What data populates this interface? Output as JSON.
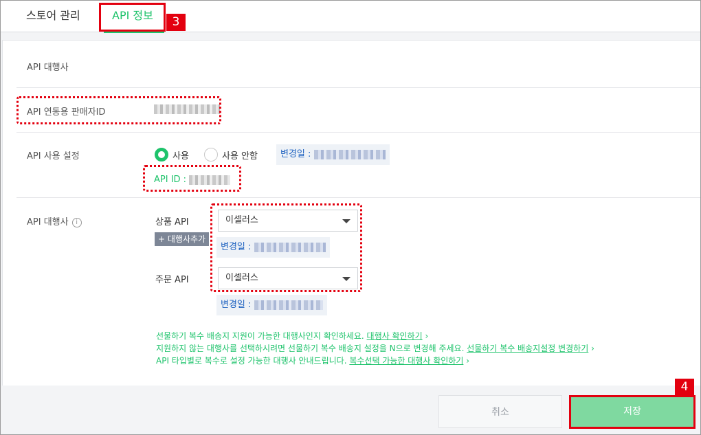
{
  "tabs": {
    "store_manage": "스토어 관리",
    "api_info": "API 정보",
    "badge_step3": "3"
  },
  "form": {
    "agency_label": "API 대행사",
    "seller_id_label": "API 연동용 판매자ID",
    "usage_label": "API 사용 설정",
    "usage_on": "사용",
    "usage_off": "사용 안함",
    "changed_label": "변경일 :",
    "api_id_label": "API ID :",
    "agency2_label": "API 대행사",
    "info_icon": "i",
    "product_api_label": "상품 API",
    "product_api_value": "이셀러스",
    "add_agency_button": "+ 대행사추가",
    "order_api_label": "주문 API",
    "order_api_value": "이셀러스"
  },
  "notes": {
    "line1_text": "선물하기 복수 배송지 지원이 가능한 대행사인지 확인하세요.",
    "line1_link": "대행사 확인하기",
    "line2_text": "지원하지 않는 대행사를 선택하시려면 선물하기 복수 배송지 설정을 N으로 변경해 주세요.",
    "line2_link": "선물하기 복수 배송지설정 변경하기",
    "line3_text": "API 타입별로 복수로 설정 가능한 대행사 안내드립니다.",
    "line3_link": "복수선택 가능한 대행사 확인하기",
    "arrow": "›"
  },
  "buttons": {
    "cancel": "취소",
    "save": "저장",
    "badge_step4": "4"
  },
  "colors": {
    "accent_green": "#1ec36b",
    "highlight_red": "#e3000f",
    "link_blue": "#1e62c0"
  }
}
